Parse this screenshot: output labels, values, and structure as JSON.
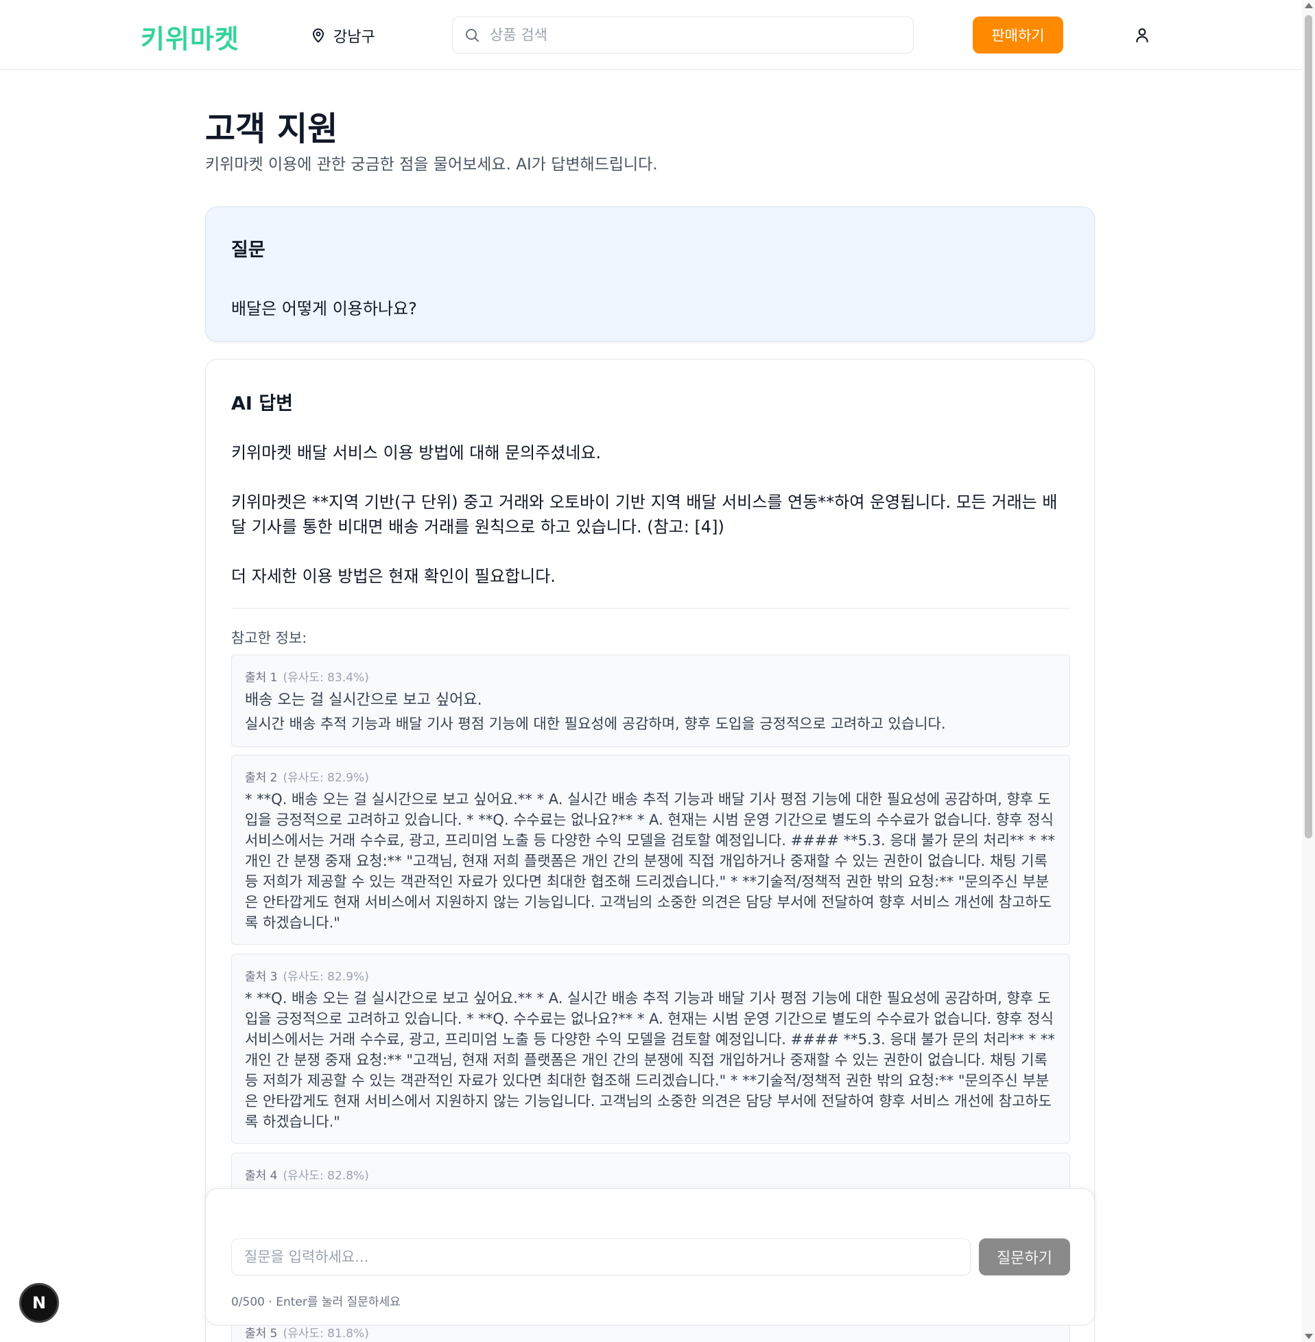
{
  "header": {
    "logo": "키위마켓",
    "location": "강남구",
    "search_placeholder": "상품 검색",
    "sell_label": "판매하기"
  },
  "main": {
    "title": "고객 지원",
    "subtitle": "키위마켓 이용에 관한 궁금한 점을 물어보세요. AI가 답변해드립니다."
  },
  "question": {
    "title": "질문",
    "text": "배달은 어떻게 이용하나요?"
  },
  "answer": {
    "title": "AI 답변",
    "paragraphs": [
      "키위마켓 배달 서비스 이용 방법에 대해 문의주셨네요.",
      "키위마켓은 **지역 기반(구 단위) 중고 거래와 오토바이 기반 지역 배달 서비스를 연동**하여 운영됩니다. 모든 거래는 배달 기사를 통한 비대면 배송 거래를 원칙으로 하고 있습니다. (참고: [4])",
      "더 자세한 이용 방법은 현재 확인이 필요합니다."
    ],
    "refs_label": "참고한 정보:",
    "refs": [
      {
        "source": "출처 1",
        "similarity": "(유사도: 83.4%)",
        "lines": [
          "배송 오는 걸 실시간으로 보고 싶어요.",
          "실시간 배송 추적 기능과 배달 기사 평점 기능에 대한 필요성에 공감하며, 향후 도입을 긍정적으로 고려하고 있습니다."
        ]
      },
      {
        "source": "출처 2",
        "similarity": "(유사도: 82.9%)",
        "lines": [
          "* **Q. 배송 오는 걸 실시간으로 보고 싶어요.** * A. 실시간 배송 추적 기능과 배달 기사 평점 기능에 대한 필요성에 공감하며, 향후 도입을 긍정적으로 고려하고 있습니다. * **Q. 수수료는 없나요?** * A. 현재는 시범 운영 기간으로 별도의 수수료가 없습니다. 향후 정식 서비스에서는 거래 수수료, 광고, 프리미엄 노출 등 다양한 수익 모델을 검토할 예정입니다. #### **5.3. 응대 불가 문의 처리** * **개인 간 분쟁 중재 요청:** \"고객님, 현재 저희 플랫폼은 개인 간의 분쟁에 직접 개입하거나 중재할 수 있는 권한이 없습니다. 채팅 기록 등 저희가 제공할 수 있는 객관적인 자료가 있다면 최대한 협조해 드리겠습니다.\" * **기술적/정책적 권한 밖의 요청:** \"문의주신 부분은 안타깝게도 현재 서비스에서 지원하지 않는 기능입니다. 고객님의 소중한 의견은 담당 부서에 전달하여 향후 서비스 개선에 참고하도록 하겠습니다.\""
        ]
      },
      {
        "source": "출처 3",
        "similarity": "(유사도: 82.9%)",
        "lines": [
          "* **Q. 배송 오는 걸 실시간으로 보고 싶어요.** * A. 실시간 배송 추적 기능과 배달 기사 평점 기능에 대한 필요성에 공감하며, 향후 도입을 긍정적으로 고려하고 있습니다. * **Q. 수수료는 없나요?** * A. 현재는 시범 운영 기간으로 별도의 수수료가 없습니다. 향후 정식 서비스에서는 거래 수수료, 광고, 프리미엄 노출 등 다양한 수익 모델을 검토할 예정입니다. #### **5.3. 응대 불가 문의 처리** * **개인 간 분쟁 중재 요청:** \"고객님, 현재 저희 플랫폼은 개인 간의 분쟁에 직접 개입하거나 중재할 수 있는 권한이 없습니다. 채팅 기록 등 저희가 제공할 수 있는 객관적인 자료가 있다면 최대한 협조해 드리겠습니다.\" * **기술적/정책적 권한 밖의 요청:** \"문의주신 부분은 안타깝게도 현재 서비스에서 지원하지 않는 기능입니다. 고객님의 소중한 의견은 담당 부서에 전달하여 향후 서비스 개선에 참고하도록 하겠습니다.\""
        ]
      },
      {
        "source": "출처 4",
        "similarity": "(유사도: 82.8%)",
        "lines": []
      },
      {
        "source": "출처 5",
        "similarity": "(유사도: 81.8%)",
        "lines": []
      }
    ]
  },
  "composer": {
    "placeholder": "질문을 입력하세요...",
    "submit_label": "질문하기",
    "helper": "0/500 · Enter를 눌러 질문하세요"
  },
  "dev_badge": "N",
  "colors": {
    "brand": "#34d399",
    "sell_button": "#ff8a00",
    "question_bg": "#eff6ff",
    "submit_disabled": "#8a8a8a"
  }
}
